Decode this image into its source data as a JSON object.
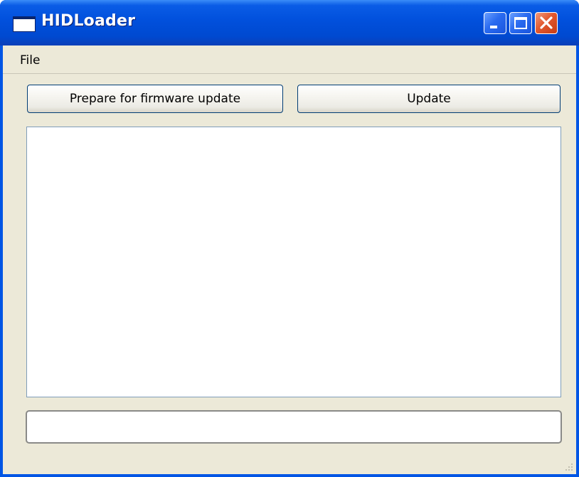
{
  "window": {
    "title": "HIDLoader"
  },
  "menubar": {
    "items": [
      {
        "label": "File"
      }
    ]
  },
  "toolbar": {
    "prepare_label": "Prepare for firmware update",
    "update_label": "Update"
  },
  "log": {
    "text": ""
  },
  "status": {
    "value": ""
  },
  "colors": {
    "titlebar": "#0055E5",
    "client_background": "#ECE9D8",
    "close_button": "#E2592F",
    "button_border": "#003C74"
  },
  "icons": {
    "app": "window-icon",
    "minimize": "minimize-icon",
    "maximize": "maximize-icon",
    "close": "close-icon",
    "resize": "resize-grip-icon"
  }
}
